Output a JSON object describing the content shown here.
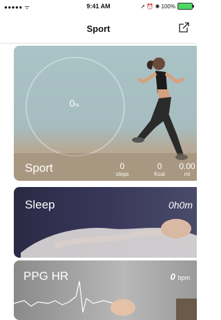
{
  "status_bar": {
    "signal": "●●●●● ᯤ",
    "time": "9:41 AM",
    "right": "➚ ⏰ ✱ 100%"
  },
  "nav": {
    "title": "Sport",
    "share_icon": "share-icon"
  },
  "sport_card": {
    "title": "Sport",
    "progress_value": "0",
    "progress_unit": "%",
    "stats": [
      {
        "value": "0",
        "unit": "steps"
      },
      {
        "value": "0",
        "unit": "Kcal"
      },
      {
        "value": "0.00",
        "unit": "mi"
      }
    ]
  },
  "sleep_card": {
    "title": "Sleep",
    "value": "0h0m"
  },
  "ppg_card": {
    "title": "PPG HR",
    "value": "0",
    "unit": "bpm"
  }
}
